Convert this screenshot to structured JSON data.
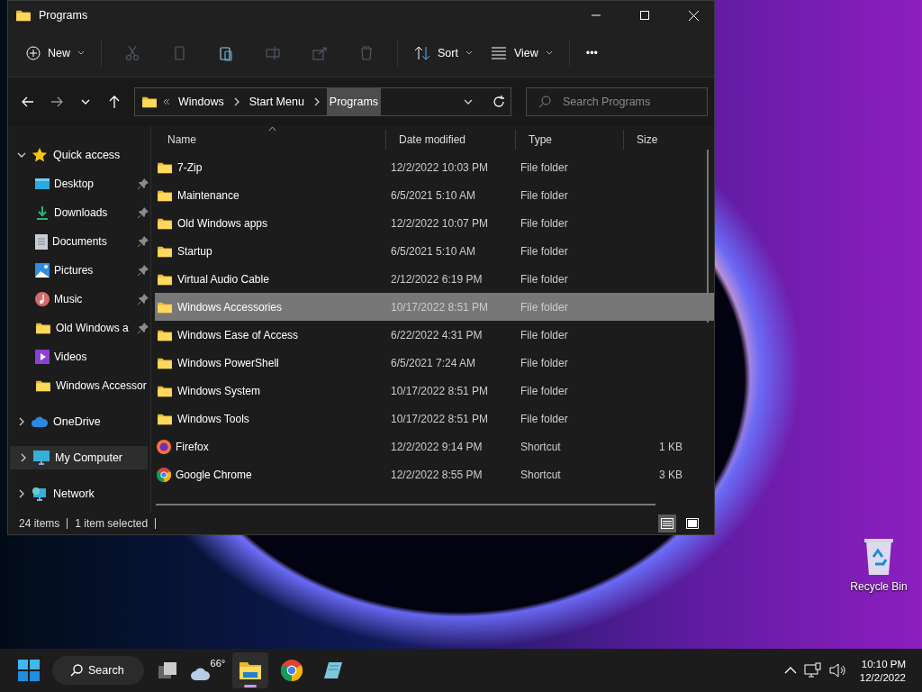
{
  "window": {
    "title": "Programs"
  },
  "command_bar": {
    "new_label": "New",
    "sort_label": "Sort",
    "view_label": "View",
    "more_label": "•••"
  },
  "address_bar": {
    "crumbs": [
      {
        "label": "Windows",
        "highlighted": false
      },
      {
        "label": "Start Menu",
        "highlighted": false
      },
      {
        "label": "Programs",
        "highlighted": true
      }
    ]
  },
  "search": {
    "placeholder": "Search Programs"
  },
  "navigation": [
    {
      "label": "Quick access",
      "kind": "star",
      "expanded": true,
      "selected": false,
      "children": [
        {
          "label": "Desktop",
          "kind": "desktop",
          "pinned": true
        },
        {
          "label": "Downloads",
          "kind": "download",
          "pinned": true
        },
        {
          "label": "Documents",
          "kind": "document",
          "pinned": true
        },
        {
          "label": "Pictures",
          "kind": "picture",
          "pinned": true
        },
        {
          "label": "Music",
          "kind": "music",
          "pinned": true
        },
        {
          "label": "Old Windows a",
          "kind": "folder",
          "pinned": true
        },
        {
          "label": "Videos",
          "kind": "video",
          "pinned": false
        },
        {
          "label": "Windows Accessor",
          "kind": "folder",
          "pinned": false
        }
      ]
    },
    {
      "label": "OneDrive",
      "kind": "cloud",
      "expanded": false,
      "selected": false
    },
    {
      "label": "My Computer",
      "kind": "computer",
      "expanded": false,
      "selected": true
    },
    {
      "label": "Network",
      "kind": "network",
      "expanded": false,
      "selected": false
    }
  ],
  "file_list": {
    "columns": [
      "Name",
      "Date modified",
      "Type",
      "Size"
    ],
    "rows": [
      {
        "name": "7-Zip",
        "date": "12/2/2022 10:03 PM",
        "type": "File folder",
        "kind": "folder",
        "selected": false
      },
      {
        "name": "Maintenance",
        "date": "6/5/2021 5:10 AM",
        "type": "File folder",
        "kind": "folder",
        "selected": false
      },
      {
        "name": "Old Windows apps",
        "date": "12/2/2022 10:07 PM",
        "type": "File folder",
        "kind": "folder",
        "selected": false
      },
      {
        "name": "Startup",
        "date": "6/5/2021 5:10 AM",
        "type": "File folder",
        "kind": "folder",
        "selected": false
      },
      {
        "name": "Virtual Audio Cable",
        "date": "2/12/2022 6:19 PM",
        "type": "File folder",
        "kind": "folder",
        "selected": false
      },
      {
        "name": "Windows Accessories",
        "date": "10/17/2022 8:51 PM",
        "type": "File folder",
        "kind": "folder",
        "selected": true
      },
      {
        "name": "Windows Ease of Access",
        "date": "6/22/2022 4:31 PM",
        "type": "File folder",
        "kind": "folder",
        "selected": false
      },
      {
        "name": "Windows PowerShell",
        "date": "6/5/2021 7:24 AM",
        "type": "File folder",
        "kind": "folder",
        "selected": false
      },
      {
        "name": "Windows System",
        "date": "10/17/2022 8:51 PM",
        "type": "File folder",
        "kind": "folder",
        "selected": false
      },
      {
        "name": "Windows Tools",
        "date": "10/17/2022 8:51 PM",
        "type": "File folder",
        "kind": "folder",
        "selected": false
      },
      {
        "name": "Firefox",
        "date": "12/2/2022 9:14 PM",
        "type": "Shortcut",
        "size": "1 KB",
        "kind": "firefox",
        "selected": false
      },
      {
        "name": "Google Chrome",
        "date": "12/2/2022 8:55 PM",
        "type": "Shortcut",
        "size": "3 KB",
        "kind": "chrome",
        "selected": false
      }
    ]
  },
  "status_bar": {
    "item_count": "24 items",
    "selection": "1 item selected",
    "views": [
      {
        "kind": "details",
        "selected": true
      },
      {
        "kind": "tiles",
        "selected": false
      }
    ]
  },
  "desktop": {
    "icons": [
      {
        "label": "Recycle Bin"
      }
    ]
  },
  "taskbar": {
    "search_label": "Search",
    "weather": "66°",
    "apps": [
      {
        "kind": "explorer",
        "active": true
      },
      {
        "kind": "chrome",
        "active": false
      },
      {
        "kind": "notepad",
        "active": false
      }
    ],
    "time": "10:10 PM",
    "date": "12/2/2022"
  }
}
